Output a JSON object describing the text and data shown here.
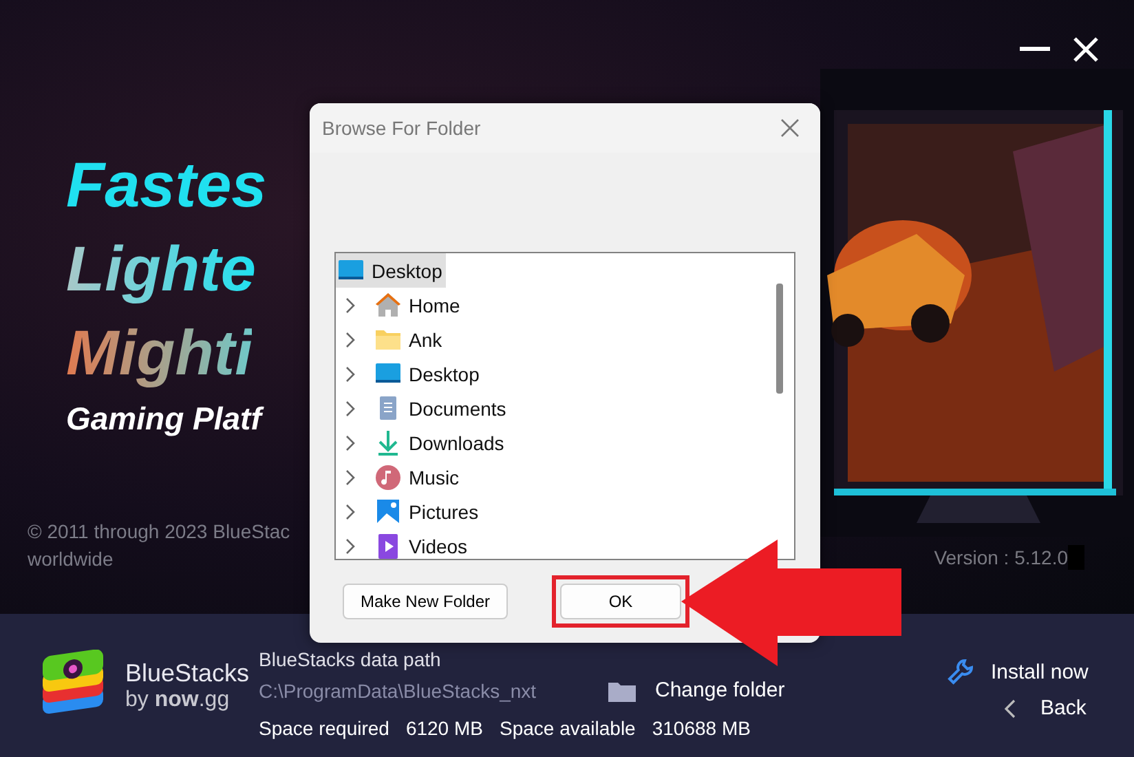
{
  "hero": {
    "headline": [
      "Fastes",
      "Lighte",
      "Mighti"
    ],
    "tagline": "Gaming Platf",
    "copyright": [
      "© 2011 through 2023 BlueStac",
      "worldwide"
    ],
    "version": "Version : 5.12.0"
  },
  "dialog": {
    "title": "Browse For Folder",
    "tree": {
      "label": "Desktop",
      "kind": "desktop",
      "selected": true,
      "children": [
        {
          "label": "Home",
          "kind": "home",
          "expanded": false,
          "selected": false
        },
        {
          "label": "Ank",
          "kind": "folder",
          "expanded": false,
          "selected": false
        },
        {
          "label": "Desktop",
          "kind": "desktop",
          "expanded": false,
          "selected": false
        },
        {
          "label": "Documents",
          "kind": "documents",
          "expanded": false,
          "selected": false
        },
        {
          "label": "Downloads",
          "kind": "downloads",
          "expanded": false,
          "selected": false
        },
        {
          "label": "Music",
          "kind": "music",
          "expanded": false,
          "selected": false
        },
        {
          "label": "Pictures",
          "kind": "pictures",
          "expanded": false,
          "selected": false
        },
        {
          "label": "Videos",
          "kind": "videos",
          "expanded": false,
          "selected": false
        }
      ]
    },
    "buttons": [
      {
        "label": "Make New Folder",
        "highlighted": false
      },
      {
        "label": "OK",
        "highlighted": true
      }
    ]
  },
  "footer": {
    "brand": "BlueStacks",
    "brand_sub": "by **now**.gg",
    "data_path_label": "BlueStacks data path",
    "data_path": "C:\\ProgramData\\BlueStacks_nxt",
    "change_folder": "Change folder",
    "space_required_label": "Space required",
    "space_required": "6120 MB",
    "space_available_label": "Space available",
    "space_available": "310688 MB",
    "install": "Install now",
    "back": "Back"
  }
}
